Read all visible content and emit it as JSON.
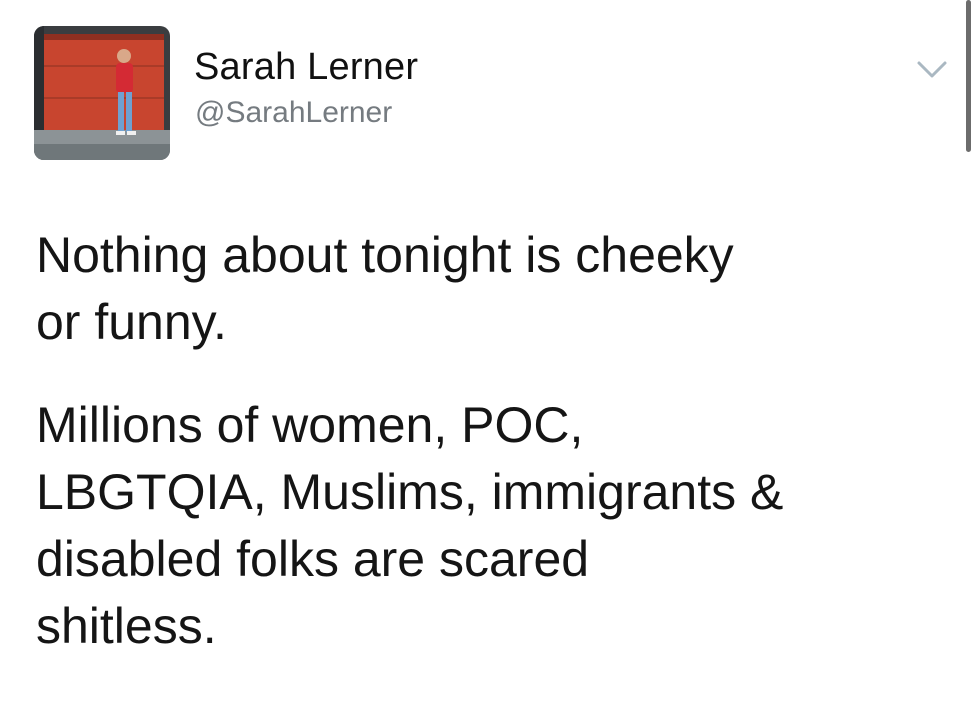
{
  "user": {
    "name": "Sarah Lerner",
    "handle": "@SarahLerner",
    "avatar_icon": "profile-photo"
  },
  "menu": {
    "icon": "chevron-down-icon"
  },
  "tweet": {
    "paragraph1_line1": "Nothing about tonight is cheeky",
    "paragraph1_line2": "or funny.",
    "paragraph2_line1": "Millions of women, POC,",
    "paragraph2_line2": "LBGTQIA, Muslims, immigrants &",
    "paragraph2_line3": "disabled folks are scared",
    "paragraph2_line4": "shitless."
  },
  "colors": {
    "text": "#151515",
    "handle": "#757b80",
    "chevron": "#aab8c2"
  }
}
